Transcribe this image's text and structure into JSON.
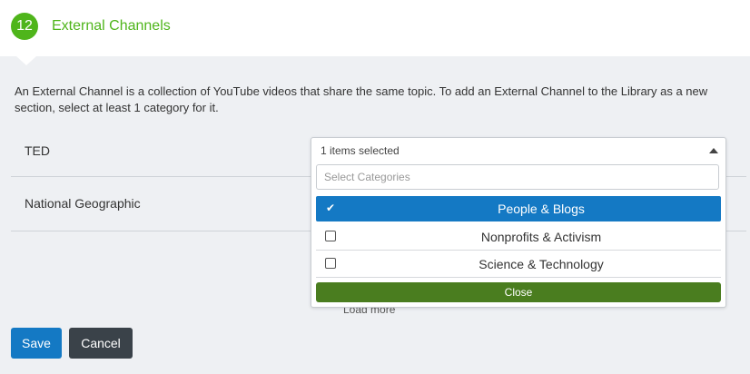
{
  "header": {
    "step_number": "12",
    "title": "External Channels"
  },
  "description": "An External Channel is a collection of YouTube videos that share the same topic. To add an External Channel to the Library as a new section, select at least 1 category for it.",
  "channels": [
    {
      "name": "TED"
    },
    {
      "name": "National Geographic"
    }
  ],
  "load_more": "Load more",
  "dropdown": {
    "summary": "1 items selected",
    "search_placeholder": "Select Categories",
    "options": [
      {
        "label": "People & Blogs",
        "selected": true
      },
      {
        "label": "Nonprofits & Activism",
        "selected": false
      },
      {
        "label": "Science & Technology",
        "selected": false
      }
    ],
    "close_label": "Close"
  },
  "actions": {
    "save_label": "Save",
    "cancel_label": "Cancel"
  },
  "colors": {
    "accent_green": "#4fb51b",
    "primary_blue": "#1479c4",
    "close_green": "#4a7d1f",
    "cancel_dark": "#3a4249"
  }
}
